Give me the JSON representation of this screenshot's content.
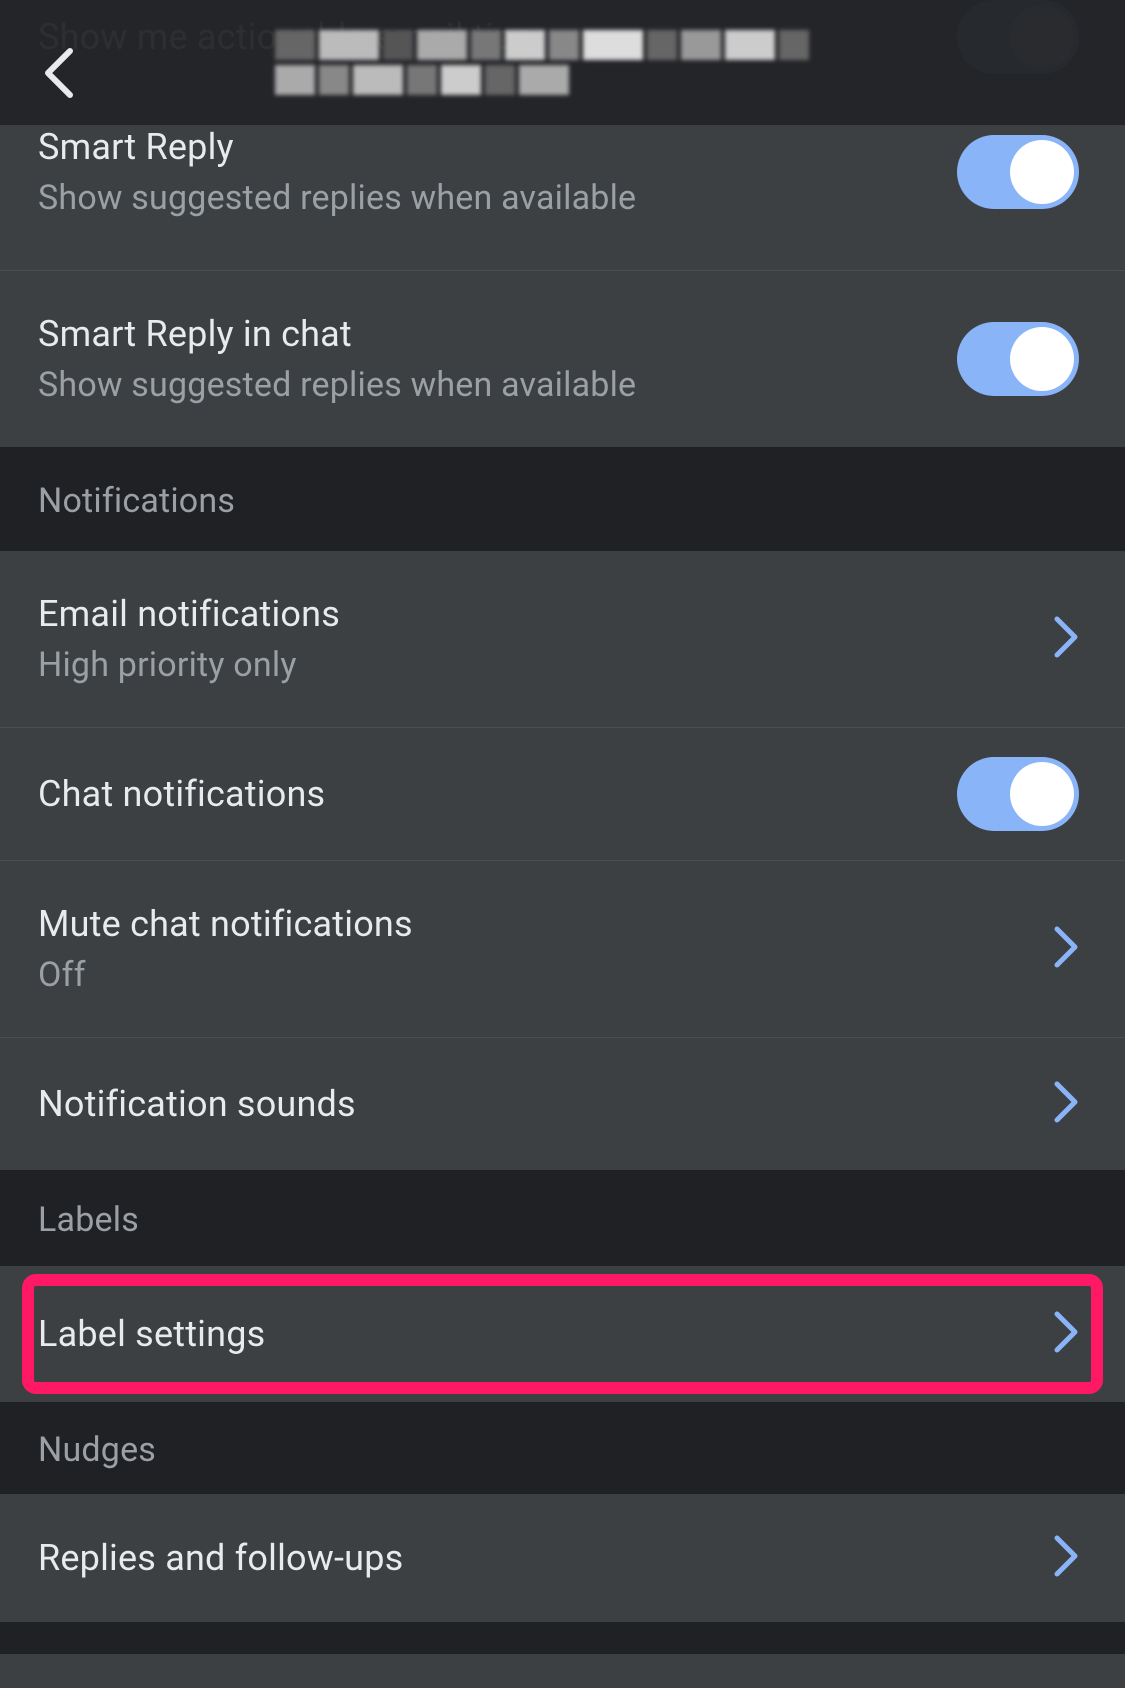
{
  "rows": {
    "r0": {
      "title": "Show me actionable email tips",
      "toggle": true
    },
    "r1": {
      "title": "Smart Reply",
      "sub": "Show suggested replies when available",
      "toggle": true
    },
    "r2": {
      "title": "Smart Reply in chat",
      "sub": "Show suggested replies when available",
      "toggle": true
    }
  },
  "sections": {
    "notifications": "Notifications",
    "labels": "Labels",
    "nudges": "Nudges"
  },
  "notif": {
    "email": {
      "title": "Email notifications",
      "sub": "High priority only"
    },
    "chat": {
      "title": "Chat notifications",
      "toggle": true
    },
    "mute": {
      "title": "Mute chat notifications",
      "sub": "Off"
    },
    "sounds": {
      "title": "Notification sounds"
    }
  },
  "labels": {
    "settings": "Label settings"
  },
  "nudges": {
    "replies": "Replies and follow-ups"
  }
}
